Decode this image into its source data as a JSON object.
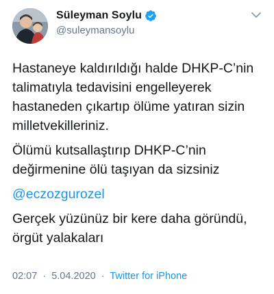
{
  "tweet": {
    "author": {
      "display_name": "Süleyman Soylu",
      "handle": "@suleymansoylu",
      "verified": true,
      "avatar_icon": "profile-photo"
    },
    "more_icon": "chevron-down-icon",
    "paragraphs": [
      {
        "lines": [
          "Hastaneye kaldırıldığı halde DHKP-C’nin",
          "talimatıyla tedavisini engelleyerek",
          "hastaneden çıkartıp ölüme yatıran sizin",
          "milletvekilleriniz."
        ]
      },
      {
        "lines": [
          "Ölümü kutsallaştırıp DHKP-C’nin",
          "değirmenine ölü taşıyan da sizsiniz"
        ]
      },
      {
        "mention": "@eczozgurozel"
      },
      {
        "lines": [
          "Gerçek yüzünüz bir kere daha göründü,",
          "örgüt yalakaları"
        ]
      }
    ],
    "meta": {
      "time": "02:07",
      "separator": "·",
      "date": "5.04.2020",
      "source": "Twitter for iPhone"
    },
    "colors": {
      "text": "#14171a",
      "secondary": "#657786",
      "link": "#1b95e0",
      "verified_badge": "#1da1f2"
    }
  }
}
